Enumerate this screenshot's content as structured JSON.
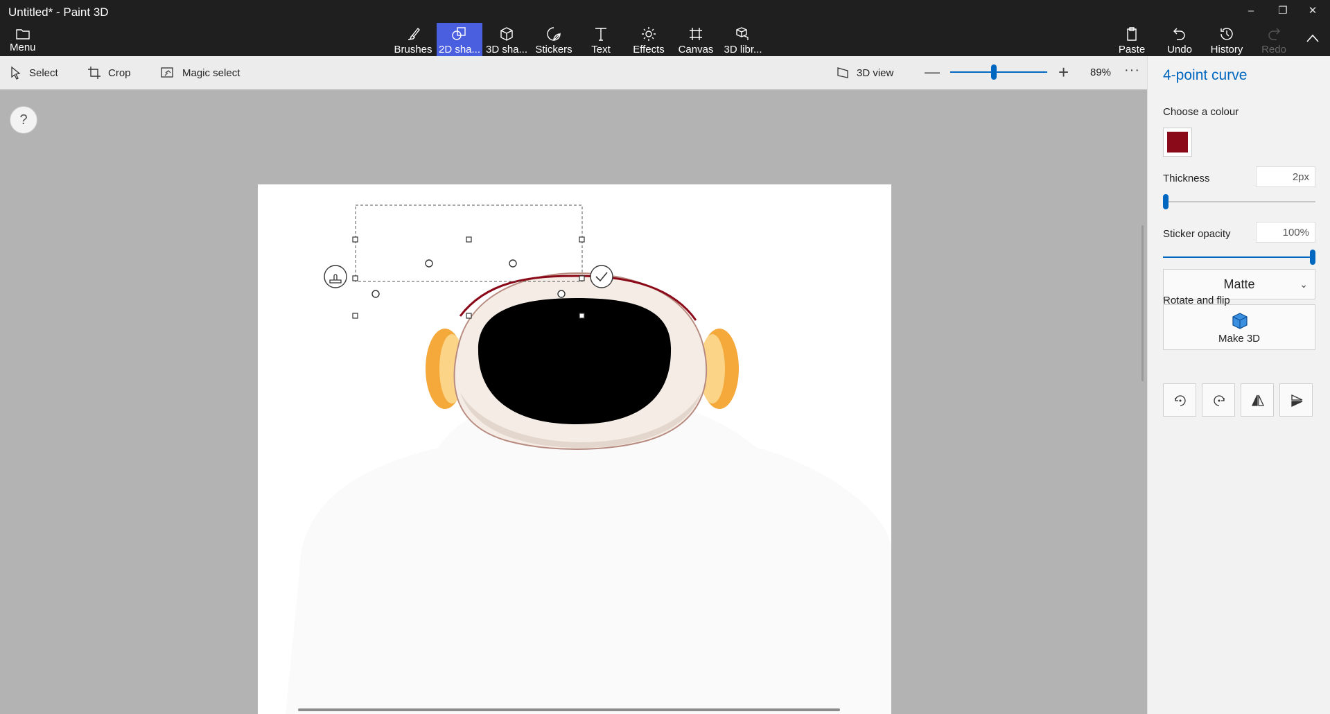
{
  "window": {
    "title": "Untitled* - Paint 3D",
    "minimize": "–",
    "restore": "❐",
    "close": "✕"
  },
  "menu": {
    "label": "Menu"
  },
  "ribbon": {
    "tools": [
      {
        "label": "Brushes",
        "icon": "brush-icon"
      },
      {
        "label": "2D sha...",
        "icon": "2d-shapes-icon"
      },
      {
        "label": "3D sha...",
        "icon": "3d-shapes-icon"
      },
      {
        "label": "Stickers",
        "icon": "sticker-icon"
      },
      {
        "label": "Text",
        "icon": "text-icon"
      },
      {
        "label": "Effects",
        "icon": "effects-icon"
      },
      {
        "label": "Canvas",
        "icon": "canvas-icon"
      },
      {
        "label": "3D libr...",
        "icon": "3d-library-icon"
      }
    ],
    "active_tool": "2D sha...",
    "actions": [
      {
        "label": "Paste",
        "icon": "paste-icon"
      },
      {
        "label": "Undo",
        "icon": "undo-icon"
      },
      {
        "label": "History",
        "icon": "history-icon"
      },
      {
        "label": "Redo",
        "icon": "redo-icon",
        "disabled": true
      }
    ],
    "collapse_icon": "chevron-up-icon"
  },
  "subbar": {
    "select": "Select",
    "crop": "Crop",
    "magic_select": "Magic select",
    "view3d": "3D view",
    "zoom_minus": "—",
    "zoom_plus": "+",
    "zoom_value": "89%",
    "zoom_fraction": 0.45,
    "more": "···"
  },
  "canvas": {
    "help": "?"
  },
  "panel": {
    "title": "4-point curve",
    "choose_colour": "Choose a colour",
    "colour": "#8b0a1a",
    "thickness_label": "Thickness",
    "thickness_value": "2px",
    "thickness_fraction": 0.0,
    "opacity_label": "Sticker opacity",
    "opacity_value": "100%",
    "opacity_fraction": 1.0,
    "finish": "Matte",
    "make3d": "Make 3D",
    "rotate_label": "Rotate and flip"
  },
  "colors": {
    "accent": "#0067c0",
    "active_tool": "#4a5ee0",
    "topbar": "#1f1f1f"
  }
}
